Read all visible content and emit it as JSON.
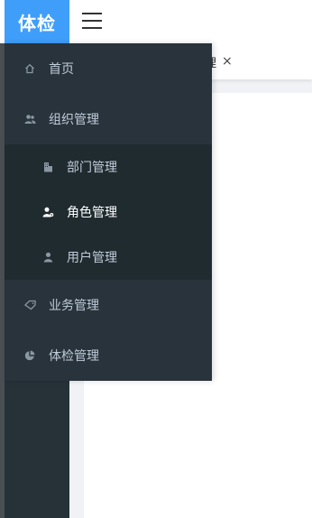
{
  "header": {
    "logo_text": "体检"
  },
  "tabs": {
    "active_label": "理",
    "close_glyph": "×"
  },
  "menu": {
    "items": [
      {
        "label": "首页",
        "icon": "home-icon"
      },
      {
        "label": "组织管理",
        "icon": "users-icon",
        "expanded": true,
        "children": [
          {
            "label": "部门管理",
            "icon": "building-icon"
          },
          {
            "label": "角色管理",
            "icon": "user-gear-icon",
            "active": true
          },
          {
            "label": "用户管理",
            "icon": "user-icon"
          }
        ]
      },
      {
        "label": "业务管理",
        "icon": "tag-icon"
      },
      {
        "label": "体检管理",
        "icon": "pie-chart-icon"
      }
    ]
  },
  "colors": {
    "logo_bg": "#3f9ef9",
    "menu_bg": "#28333b",
    "submenu_bg": "#202b30",
    "menu_text": "#bfcbd9",
    "active_text": "#ffffff"
  }
}
